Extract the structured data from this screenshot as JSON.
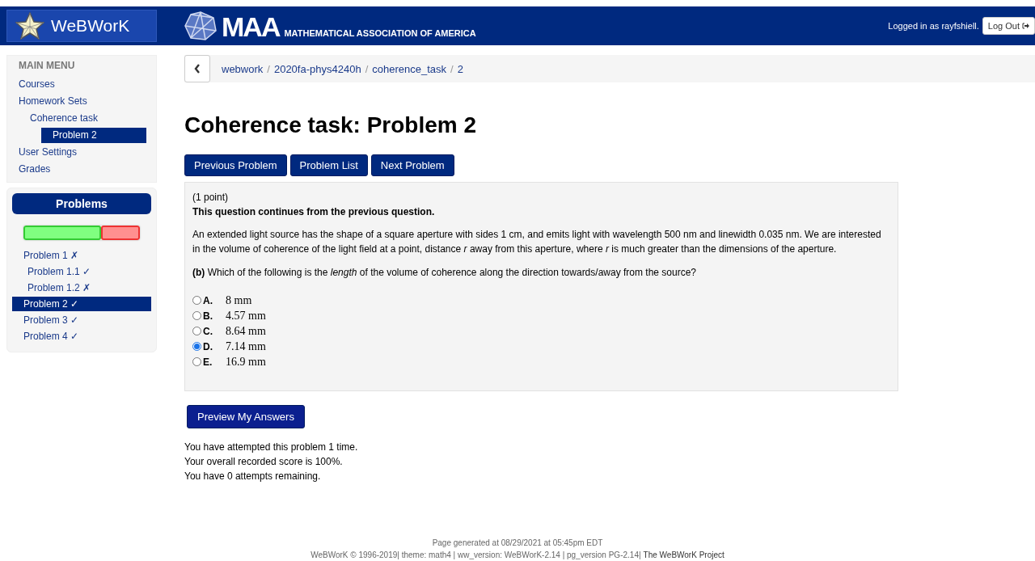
{
  "header": {
    "brand": "WeBWorK",
    "maa_logo": "MAA",
    "maa_name": "MATHEMATICAL ASSOCIATION OF AMERICA",
    "logged_in": "Logged in as rayfshiell.",
    "logout": "Log Out"
  },
  "breadcrumb": [
    "webwork",
    "2020fa-phys4240h",
    "coherence_task",
    "2"
  ],
  "breadcrumb_separator": "/",
  "main_menu": {
    "title": "MAIN MENU",
    "items": [
      {
        "label": "Courses",
        "selected": false
      },
      {
        "label": "Homework Sets",
        "selected": false,
        "children": [
          {
            "label": "Coherence task",
            "selected": false,
            "children": [
              {
                "label": "Problem 2",
                "selected": true
              }
            ]
          }
        ]
      },
      {
        "label": "User Settings",
        "selected": false
      },
      {
        "label": "Grades",
        "selected": false
      }
    ]
  },
  "problems_panel": {
    "title": "Problems",
    "level": 0.67,
    "items": [
      {
        "label": "Problem 1 ✗",
        "selected": false,
        "children": [
          {
            "label": "Problem 1.1 ✓",
            "selected": false
          },
          {
            "label": "Problem 1.2 ✗",
            "selected": false
          }
        ]
      },
      {
        "label": "Problem 2 ✓",
        "selected": true
      },
      {
        "label": "Problem 3 ✓",
        "selected": false
      },
      {
        "label": "Problem 4 ✓",
        "selected": false
      }
    ]
  },
  "title": "Coherence task: Problem 2",
  "nav_buttons": [
    "Previous Problem",
    "Problem List",
    "Next Problem"
  ],
  "problem": {
    "points": "(1 point)",
    "note": "This question continues from the previous question.",
    "body": "An extended light source has the shape of a square aperture with sides 1 cm, and emits light with wavelength 500 nm and linewidth 0.035 nm. We are interested in the volume of coherence of the light field at a point, distance *r* away from this aperture, where *r* is much greater than the dimensions of the aperture.",
    "question": "**(b)** Which of the following is the *length* of the volume of coherence along the direction towards/away from the source?",
    "options": [
      {
        "letter": "A.",
        "value": "8 mm",
        "selected": false
      },
      {
        "letter": "B.",
        "value": "4.57 mm",
        "selected": false
      },
      {
        "letter": "C.",
        "value": "8.64 mm",
        "selected": false
      },
      {
        "letter": "D.",
        "value": "7.14 mm",
        "selected": true
      },
      {
        "letter": "E.",
        "value": "16.9 mm",
        "selected": false
      }
    ]
  },
  "preview_button": "Preview My Answers",
  "attempt_info": [
    "You have attempted this problem 1 time.",
    "Your overall recorded score is 100%.",
    "You have 0 attempts remaining."
  ],
  "footer": {
    "generated": "Page generated at 08/29/2021 at 05:45pm EDT",
    "versions": "WeBWorK © 1996-2019| theme: math4 | ww_version: WeBWorK-2.14 | pg_version PG-2.14|",
    "project_link": "The WeBWorK Project"
  }
}
